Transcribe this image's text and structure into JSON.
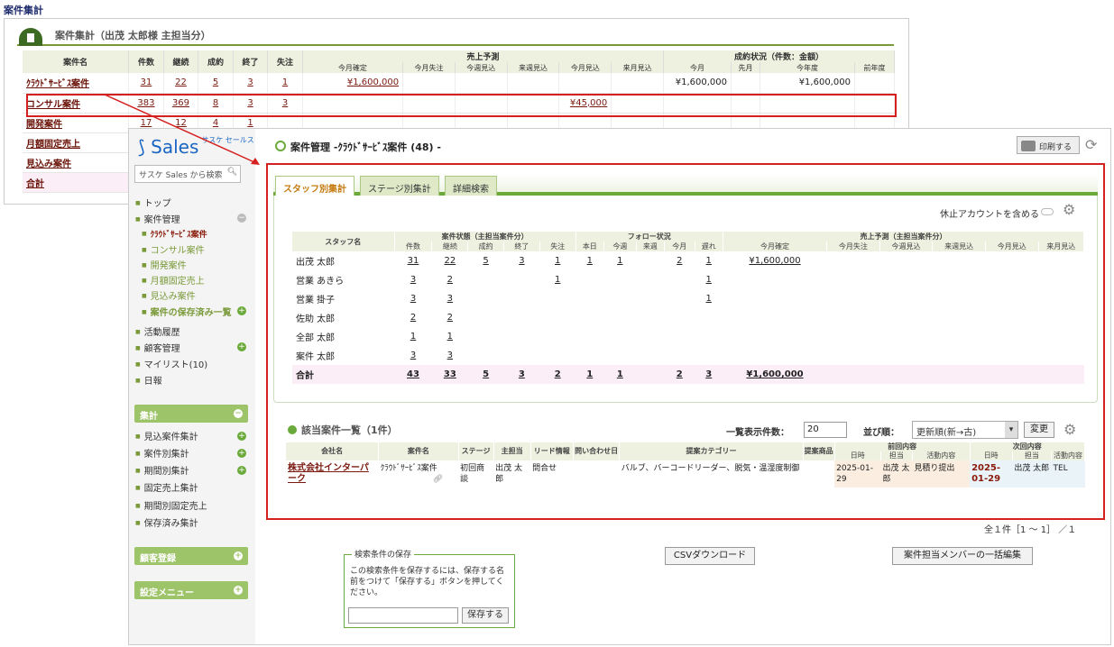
{
  "page": {
    "title": "案件集計"
  },
  "back": {
    "title": "案件集計（出茂 太郎様 主担当分）",
    "headers": {
      "name": "案件名",
      "count": "件数",
      "cont": "継続",
      "won": "成約",
      "done": "終了",
      "lost": "失注",
      "forecast": "売上予測",
      "result": "成約状況（件数：金額）"
    },
    "subheaders": [
      "今月確定",
      "今月失注",
      "今週見込",
      "来週見込",
      "今月見込",
      "来月見込",
      "今月",
      "先月",
      "今年度",
      "前年度"
    ],
    "rows": [
      {
        "name": "ｸﾗｳﾄﾞｻｰﾋﾞｽ案件",
        "c": "31",
        "k": "22",
        "s": "5",
        "e": "3",
        "l": "1",
        "f1": "¥1,600,000",
        "f5": "",
        "r1": "¥1,600,000",
        "r3": "¥1,600,000"
      },
      {
        "name": "コンサル案件",
        "c": "383",
        "k": "369",
        "s": "8",
        "e": "3",
        "l": "3",
        "f1": "",
        "f5": "¥45,000",
        "r1": "",
        "r3": ""
      },
      {
        "name": "開発案件",
        "c": "17",
        "k": "12",
        "s": "4",
        "e": "1",
        "l": "",
        "f1": "",
        "f5": "",
        "r1": "",
        "r3": ""
      },
      {
        "name": "月額固定売上",
        "c": "",
        "k": "",
        "s": "",
        "e": "",
        "l": "",
        "f1": "",
        "f5": "",
        "r1": "",
        "r3": ""
      },
      {
        "name": "見込み案件",
        "c": "",
        "k": "",
        "s": "",
        "e": "",
        "l": "",
        "f1": "",
        "f5": "",
        "r1": "",
        "r3": ""
      },
      {
        "name": "合計",
        "c": "",
        "k": "",
        "s": "",
        "e": "",
        "l": "",
        "f1": "",
        "f5": "",
        "r1": "",
        "r3": ""
      }
    ]
  },
  "sidebar": {
    "logo": "Sales",
    "logo_small": "サスケ セールス",
    "search_placeholder": "サスケ Sales から検索",
    "items": [
      "トップ",
      "案件管理",
      "ｸﾗｳﾄﾞｻｰﾋﾞｽ案件",
      "コンサル案件",
      "開発案件",
      "月額固定売上",
      "見込み案件",
      "案件の保存済み一覧",
      "活動履歴",
      "顧客管理",
      "マイリスト(10)",
      "日報"
    ],
    "group_shukei": "集計",
    "shukei_items": [
      "見込案件集計",
      "案件別集計",
      "期間別集計",
      "固定売上集計",
      "期間別固定売上",
      "保存済み集計"
    ],
    "group_customer": "顧客登録",
    "group_settings": "設定メニュー"
  },
  "main": {
    "title": "案件管理 -ｸﾗｳﾄﾞｻｰﾋﾞｽ案件 (48) -",
    "print": "印刷する",
    "tabs": [
      "スタッフ別集計",
      "ステージ別集計",
      "詳細検索"
    ],
    "include_inactive": "休止アカウントを含める",
    "staff_headers": {
      "name": "スタッフ名",
      "status": "案件状態（主担当案件分）",
      "follow": "フォロー状況",
      "forecast": "売上予測（主担当案件分）"
    },
    "staff_sub": [
      "件数",
      "継続",
      "成約",
      "終了",
      "失注",
      "本日",
      "今週",
      "来週",
      "今月",
      "遅れ",
      "今月確定",
      "今月失注",
      "今週見込",
      "来週見込",
      "今月見込",
      "来月見込"
    ],
    "staff_rows": [
      {
        "name": "出茂 太郎",
        "v": [
          "31",
          "22",
          "5",
          "3",
          "1",
          "1",
          "1",
          "",
          "2",
          "1",
          "¥1,600,000"
        ]
      },
      {
        "name": "営業 あきら",
        "v": [
          "3",
          "2",
          "",
          "",
          "1",
          "",
          "",
          "",
          "",
          "1",
          ""
        ]
      },
      {
        "name": "営業 掛子",
        "v": [
          "3",
          "3",
          "",
          "",
          "",
          "",
          "",
          "",
          "",
          "1",
          ""
        ]
      },
      {
        "name": "佐助 太郎",
        "v": [
          "2",
          "2",
          "",
          "",
          "",
          "",
          "",
          "",
          "",
          "",
          ""
        ]
      },
      {
        "name": "全部 太郎",
        "v": [
          "1",
          "1",
          "",
          "",
          "",
          "",
          "",
          "",
          "",
          "",
          ""
        ]
      },
      {
        "name": "案件 太郎",
        "v": [
          "3",
          "3",
          "",
          "",
          "",
          "",
          "",
          "",
          "",
          "",
          ""
        ]
      },
      {
        "name": "合計",
        "v": [
          "43",
          "33",
          "5",
          "3",
          "2",
          "1",
          "1",
          "",
          "2",
          "3",
          "¥1,600,000"
        ]
      }
    ],
    "list_title": "該当案件一覧（1件）",
    "count_label": "一覧表示件数：",
    "count_value": "20",
    "sort_label": "並び順：",
    "sort_value": "更新順(新→古)",
    "change": "変更",
    "list_headers": {
      "company": "会社名",
      "deal": "案件名",
      "stage": "ステージ",
      "owner": "主担当",
      "lead": "リード情報",
      "inquiry": "問い合わせ日",
      "category": "提案カテゴリー",
      "product": "提案商品",
      "prev": "前回内容",
      "next": "次回内容",
      "date": "日時",
      "person": "担当",
      "content": "活動内容"
    },
    "list_row": {
      "company": "株式会社インターパーク",
      "deal": "ｸﾗｳﾄﾞｻｰﾋﾞｽ案件",
      "stage": "初回商談",
      "owner": "出茂 太郎",
      "lead": "問合せ",
      "inquiry": "",
      "category": "バルブ、バーコードリーダー、脱気・温湿度制御",
      "product": "",
      "prev_date": "2025-01-29",
      "prev_person": "出茂 太郎",
      "prev_content": "見積り提出",
      "next_date": "2025-01-29",
      "next_person": "出茂 太郎",
      "next_content": "TEL"
    },
    "pager": "全１件［1 ～ 1］ ／１",
    "save_legend": "検索条件の保存",
    "save_text": "この検索条件を保存するには、保存する名前をつけて「保存する」ボタンを押してください。",
    "save_btn": "保存する",
    "csv": "CSVダウンロード",
    "bulk": "案件担当メンバーの一括編集"
  }
}
